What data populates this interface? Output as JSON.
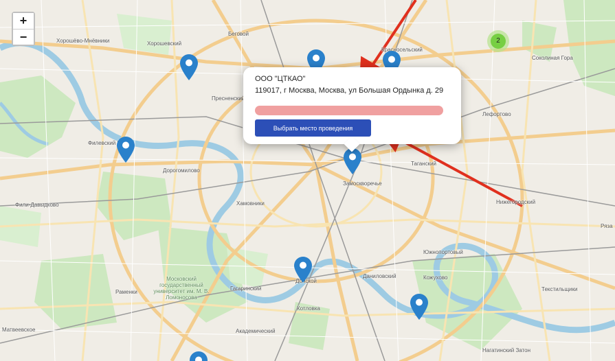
{
  "zoom": {
    "in_label": "+",
    "out_label": "−"
  },
  "cluster": {
    "count": "2"
  },
  "popup": {
    "name": "ООО \"ЦТКАО\"",
    "address": "119017, г Москва, Москва, ул Большая Ордынка д. 29",
    "select_button": "Выбрать место проведения"
  },
  "labels": {
    "khoroshevo": "Хорошёво-Мнёвники",
    "khoroshevsky": "Хорошевский",
    "begovoy": "Беговой",
    "krasnoselsky": "Красносельский",
    "sokolinaya": "Соколиная Гора",
    "presnensky": "Пресненский",
    "lefortovo": "Лефортово",
    "filevsky": "Филевский Парк",
    "dorogomilovo": "Дорогомилово",
    "tagansky": "Таганский",
    "zamoskvorechye": "Замоскворечье",
    "fili": "Фили-Давыдково",
    "khamovniki": "Хамовники",
    "nizhegorodsky": "Нижегородский",
    "yuzhnoportovy": "Южнопортовый",
    "mgu": "Московский государственный университет им. М. В. Ломоносова",
    "danilovsky": "Даниловский",
    "donskoy": "Донской",
    "kozhukhovo": "Кожухово",
    "ramenki": "Раменки",
    "gagarinsky": "Гагаринский",
    "tekstilshchiki": "Текстильщики",
    "kotlovka": "Котловка",
    "akademichesky": "Академический",
    "matveevskoe": "Матвеевское",
    "nagatinsky": "Нагатинский Затон",
    "ryazansky": "Ряза"
  },
  "colors": {
    "marker": "#2a81cb",
    "button": "#2c4fb7",
    "bar": "#f0a0a0",
    "arrow": "#e0301e",
    "cluster": "#6ecc39"
  }
}
